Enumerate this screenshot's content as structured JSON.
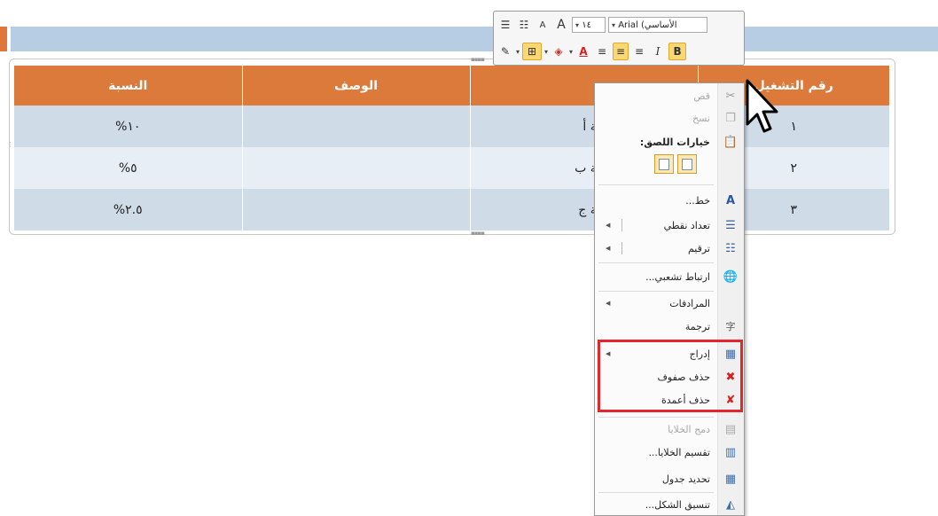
{
  "table": {
    "headers": [
      "النسبة",
      "الوصف",
      "رقم التشغيل"
    ],
    "rows": [
      [
        "%١٠",
        "لة أ",
        "١"
      ],
      [
        "%٥",
        "لة ب",
        "٢"
      ],
      [
        "%٢.٥",
        "لة ج",
        "٣"
      ]
    ]
  },
  "mini_toolbar": {
    "font_name": "Arial (الأساسي",
    "font_size": "١٤",
    "bold_label": "B",
    "italic_label": "I",
    "font_color_label": "A",
    "grow_font_label": "A",
    "shrink_font_label": "A"
  },
  "context_menu": {
    "cut": "قص",
    "copy": "نسخ",
    "paste_options": "خيارات اللصق:",
    "font": "خط...",
    "bullets": "تعداد نقطي",
    "numbering": "ترقيم",
    "hyperlink": "ارتباط تشعبي...",
    "synonyms": "المرادفات",
    "translate": "ترجمة",
    "insert": "إدراج",
    "delete_rows": "حذف صفوف",
    "delete_columns": "حذف أعمدة",
    "merge_cells": "دمج الخلايا",
    "split_cells": "تقسيم الخلايا...",
    "select_table": "تحديد جدول",
    "format_shape": "تنسيق الشكل..."
  },
  "colors": {
    "header_orange": "#dc7a3c",
    "row_blue_dark": "#d0dbe8",
    "row_blue_light": "#e8eef5",
    "highlight_red": "#e3262b",
    "button_active": "#f9d774"
  }
}
